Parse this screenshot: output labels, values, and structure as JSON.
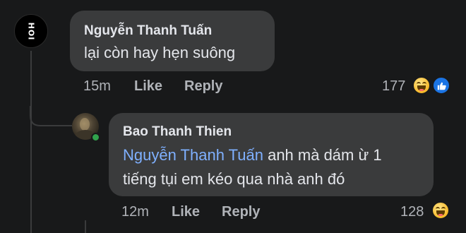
{
  "comments": [
    {
      "author": "Nguyễn Thanh Tuấn",
      "avatar_text": "HOI",
      "text": "lại còn hay hẹn suông",
      "time": "15m",
      "like_label": "Like",
      "reply_label": "Reply",
      "reaction_count": "177",
      "reactions": [
        "haha-icon",
        "like-icon"
      ]
    },
    {
      "author": "Bao Thanh Thien",
      "mention": "Nguyễn Thanh Tuấn",
      "text_line1": " anh mà dám ừ 1",
      "text_line2": "tiếng tụi em kéo qua nhà anh đó",
      "time": "12m",
      "like_label": "Like",
      "reply_label": "Reply",
      "reaction_count": "128",
      "reactions": [
        "haha-icon"
      ],
      "online": true
    }
  ],
  "colors": {
    "background": "#18191a",
    "bubble": "#3a3b3c",
    "primary_text": "#e4e6eb",
    "secondary_text": "#b0b3b8",
    "mention": "#7fb0ff",
    "like_blue": "#1b74e4",
    "haha_yellow": "#f7b928",
    "online_green": "#31a24c"
  }
}
